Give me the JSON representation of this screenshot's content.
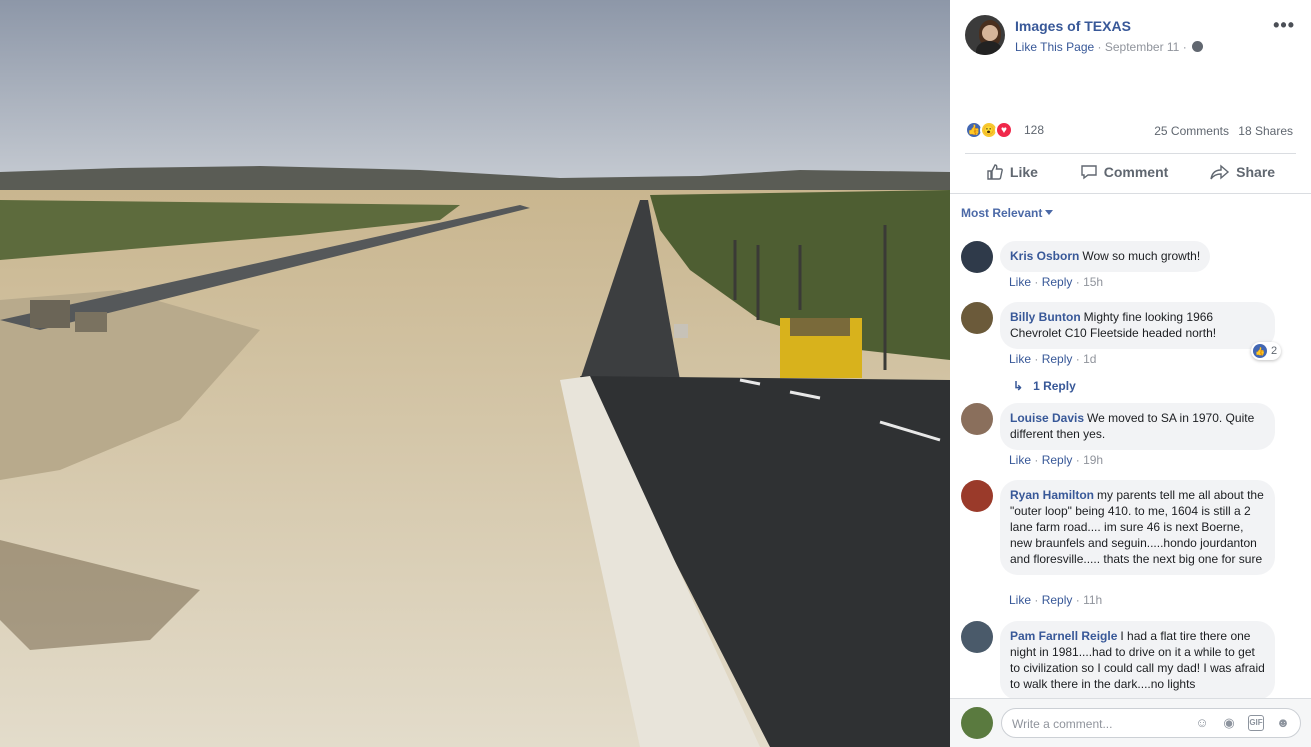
{
  "post": {
    "page_name": "Images of TEXAS",
    "like_page": "Like This Page",
    "separator": "·",
    "date": "September 11",
    "reactions_count": "128",
    "comments_count": "25 Comments",
    "shares_count": "18 Shares"
  },
  "actions": {
    "like": "Like",
    "comment": "Comment",
    "share": "Share"
  },
  "sort_label": "Most Relevant",
  "comment_actions": {
    "like": "Like",
    "reply": "Reply",
    "sep": "·"
  },
  "comments": [
    {
      "author": "Kris Osborn",
      "text": "Wow so much growth!",
      "time": "15h"
    },
    {
      "author": "Billy Bunton",
      "text": "Mighty fine looking 1966 Chevrolet C10 Fleetside headed north!",
      "time": "1d",
      "reactions": "2",
      "replies": "1 Reply"
    },
    {
      "author": "Louise Davis",
      "text": "We moved to SA in 1970. Quite different then yes.",
      "time": "19h"
    },
    {
      "author": "Ryan Hamilton",
      "text": "my parents tell me all about the \"outer loop\" being 410. to me, 1604 is still a 2 lane farm road.... im sure 46 is next Boerne, new braunfels and seguin.....hondo jourdanton and floresville..... thats the next big one for sure",
      "time": "11h"
    },
    {
      "author": "Pam Farnell Reigle",
      "text": "I had a flat tire there one night in 1981....had to drive on it a while to get to civilization so I could call my dad! I was afraid to walk there in the dark....no lights",
      "time": ""
    }
  ],
  "composer": {
    "placeholder": "Write a comment..."
  },
  "icons": [
    "more-icon",
    "globe-icon",
    "like-icon",
    "comment-icon",
    "share-icon",
    "reply-arrow-icon",
    "emoji-icon",
    "camera-icon",
    "gif-icon",
    "sticker-icon"
  ],
  "colors": {
    "link": "#385898",
    "muted": "#90949c",
    "bubble": "#f2f3f5"
  }
}
